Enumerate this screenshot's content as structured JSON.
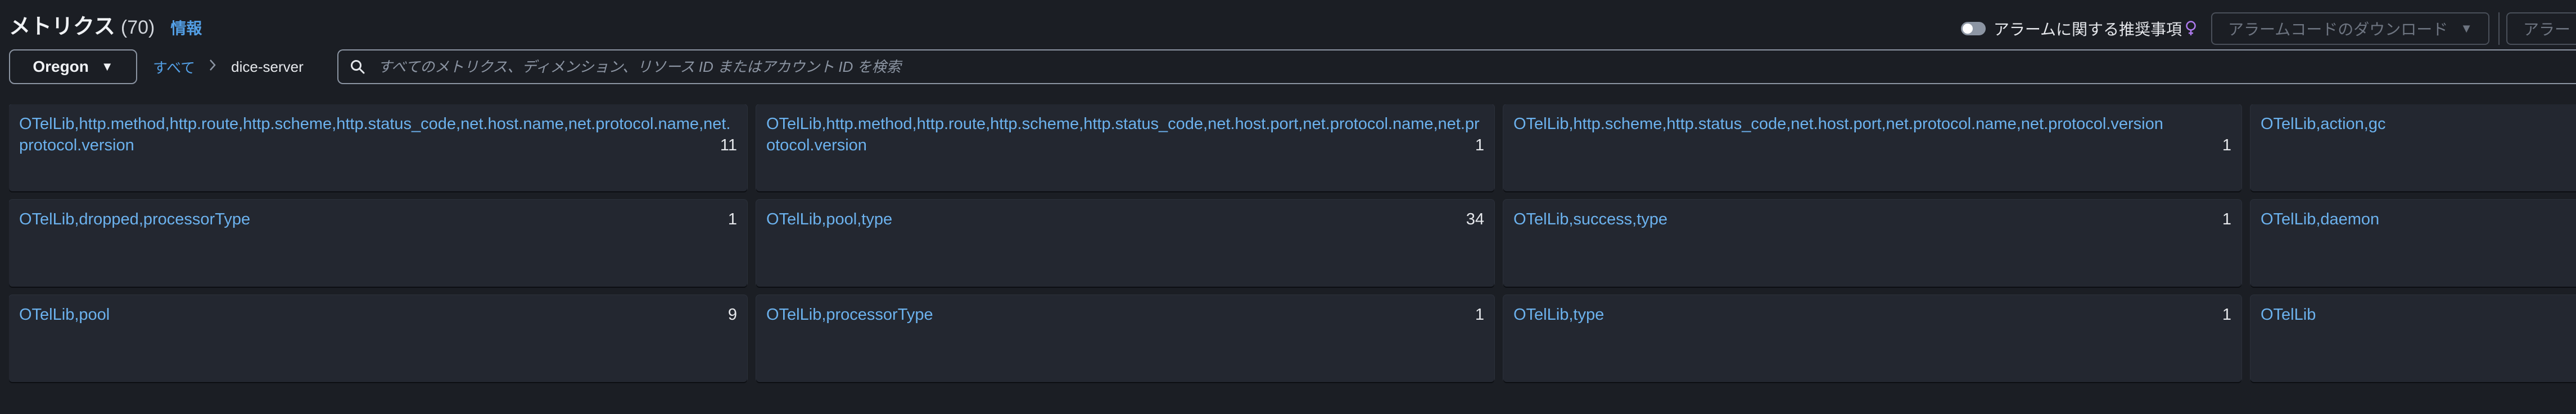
{
  "header": {
    "title": "メトリクス",
    "count": "(70)",
    "info_link": "情報",
    "recommendations_label": "アラームに関する推奨事項",
    "download_button": "アラームコードのダウンロード",
    "cut_button": "アラー",
    "icons": {
      "toggle": "toggle-switch",
      "bulb": "lightbulb-icon",
      "caret": "caret-down-icon"
    }
  },
  "filter": {
    "region": "Oregon",
    "breadcrumb_all": "すべて",
    "breadcrumb_current": "dice-server",
    "search_placeholder": "すべてのメトリクス、ディメンション、リソース ID またはアカウント ID を検索",
    "search_value": ""
  },
  "metrics": [
    {
      "name": "OTelLib,http.method,http.route,http.scheme,http.status_code,net.host.name,net.protocol.name,net.protocol.version",
      "count": "11"
    },
    {
      "name": "OTelLib,http.method,http.route,http.scheme,http.status_code,net.host.port,net.protocol.name,net.protocol.version",
      "count": "1"
    },
    {
      "name": "OTelLib,http.scheme,http.status_code,net.host.port,net.protocol.name,net.protocol.version",
      "count": "1"
    },
    {
      "name": "OTelLib,action,gc",
      "count": ""
    },
    {
      "name": "OTelLib,dropped,processorType",
      "count": "1"
    },
    {
      "name": "OTelLib,pool,type",
      "count": "34"
    },
    {
      "name": "OTelLib,success,type",
      "count": "1"
    },
    {
      "name": "OTelLib,daemon",
      "count": ""
    },
    {
      "name": "OTelLib,pool",
      "count": "9"
    },
    {
      "name": "OTelLib,processorType",
      "count": "1"
    },
    {
      "name": "OTelLib,type",
      "count": "1"
    },
    {
      "name": "OTelLib",
      "count": ""
    }
  ],
  "colors": {
    "background": "#1b1e24",
    "card": "#232730",
    "link": "#539fe5",
    "metric_link": "#6cb2ee",
    "text": "#e5e7eb",
    "disabled": "#6d7480"
  }
}
